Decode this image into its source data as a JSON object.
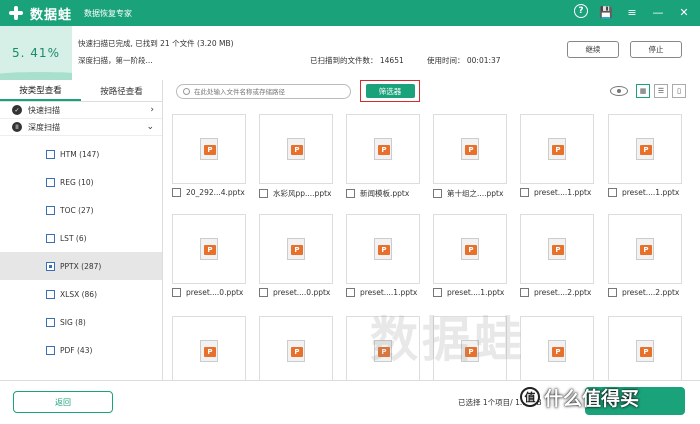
{
  "app": {
    "name": "数据蛙",
    "subtitle": "数据恢复专家"
  },
  "titlebar": {
    "help": "?",
    "save": "💾",
    "menu": "≡",
    "minimize": "—",
    "close": "✕"
  },
  "status": {
    "progress_text": "5. 41%",
    "progress_value": 0.0541,
    "quick_scan_status": "快速扫描已完成, 已找到 21 个文件 (3.20 MB)",
    "deep_scan_status": "深度扫描，第一阶段...",
    "scanned_files": "已扫描到的文件数：  14651",
    "elapsed": "使用时间：  00:01:37",
    "continue_label": "继续",
    "stop_label": "停止"
  },
  "sidebar": {
    "tabs": [
      "按类型查看",
      "按路径查看"
    ],
    "quick_scan": "快速扫描",
    "deep_scan": "深度扫描",
    "types": [
      {
        "label": "HTM (147)"
      },
      {
        "label": "REG (10)"
      },
      {
        "label": "TOC (27)"
      },
      {
        "label": "LST (6)"
      },
      {
        "label": "PPTX (287)"
      },
      {
        "label": "XLSX (86)"
      },
      {
        "label": "SIG (8)"
      },
      {
        "label": "PDF (43)"
      }
    ]
  },
  "toolbar": {
    "search_placeholder": "在此处输入文件名称或存储路径",
    "filter_label": "筛选器"
  },
  "files": [
    "20_292...4.pptx",
    "水彩风pp....pptx",
    "新闻模板.pptx",
    "第十组之....pptx",
    "preset....1.pptx",
    "preset....1.pptx",
    "preset....0.pptx",
    "preset....0.pptx",
    "preset....1.pptx",
    "preset....1.pptx",
    "preset....2.pptx",
    "preset....2.pptx",
    "",
    "",
    "",
    "",
    "",
    ""
  ],
  "bottom": {
    "back_label": "返回",
    "selection_info": "已选择  1个项目/ 1... ...B"
  },
  "watermark": "数据蛙",
  "corner_badge": {
    "glyph": "值",
    "text": "什么值得买"
  },
  "colors": {
    "accent": "#1aa37a",
    "highlight_border": "#d62b2b",
    "file_icon": "#e8702a"
  }
}
